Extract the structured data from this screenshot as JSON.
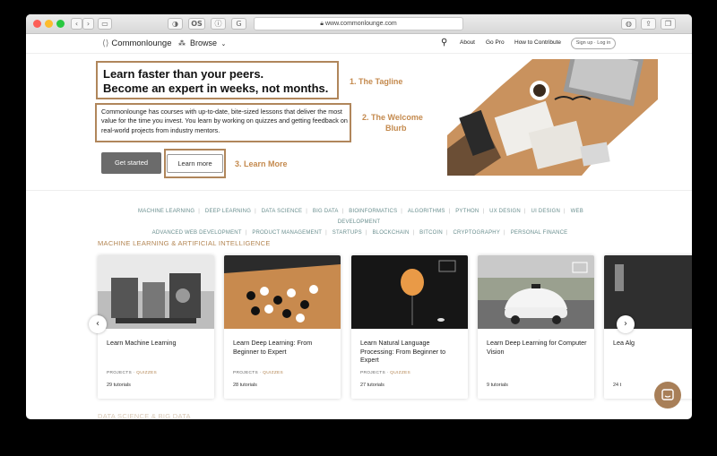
{
  "browser": {
    "url": "www.commonlounge.com",
    "tab_icons": [
      "privacy-icon",
      "os-icon",
      "info-icon",
      "grammarly-icon"
    ]
  },
  "header": {
    "logo": "Commonlounge",
    "browse": "Browse",
    "nav": [
      "About",
      "Go Pro",
      "How to Contribute"
    ],
    "signup": "Sign up · Log in"
  },
  "hero": {
    "tagline_1": "Learn faster than your peers.",
    "tagline_2": "Become an expert in weeks, not months.",
    "blurb": "Commonlounge has courses with up-to-date, bite-sized lessons that deliver the most value for the time you invest. You learn by working on quizzes and getting feedback on real-world projects from industry mentors.",
    "get_started": "Get started",
    "learn_more": "Learn more"
  },
  "annotations": {
    "tagline": "1. The Tagline",
    "blurb_1": "2. The Welcome",
    "blurb_2": "Blurb",
    "learn_more": "3. Learn More",
    "color": "#c48a4e"
  },
  "topics": [
    "MACHINE LEARNING",
    "DEEP LEARNING",
    "DATA SCIENCE",
    "BIG DATA",
    "BIOINFORMATICS",
    "ALGORITHMS",
    "PYTHON",
    "UX DESIGN",
    "UI DESIGN",
    "WEB DEVELOPMENT",
    "ADVANCED WEB DEVELOPMENT",
    "PRODUCT MANAGEMENT",
    "STARTUPS",
    "BLOCKCHAIN",
    "BITCOIN",
    "CRYPTOGRAPHY",
    "PERSONAL FINANCE"
  ],
  "section": {
    "title": "MACHINE LEARNING & ARTIFICIAL INTELLIGENCE",
    "next_title": "DATA SCIENCE & BIG DATA"
  },
  "cards": [
    {
      "title": "Learn Machine Learning",
      "projects": "PROJECTS",
      "quizzes": "QUIZZES",
      "tutorials": "29 tutorials"
    },
    {
      "title": "Learn Deep Learning: From Beginner to Expert",
      "projects": "PROJECTS",
      "quizzes": "QUIZZES",
      "tutorials": "28 tutorials"
    },
    {
      "title": "Learn Natural Language Processing: From Beginner to Expert",
      "projects": "PROJECTS",
      "quizzes": "QUIZZES",
      "tutorials": "27 tutorials"
    },
    {
      "title": "Learn Deep Learning for Computer Vision",
      "projects": "",
      "quizzes": "",
      "tutorials": "9 tutorials"
    },
    {
      "title": "Lea Alg",
      "projects": "",
      "quizzes": "",
      "tutorials": "24 t"
    }
  ]
}
